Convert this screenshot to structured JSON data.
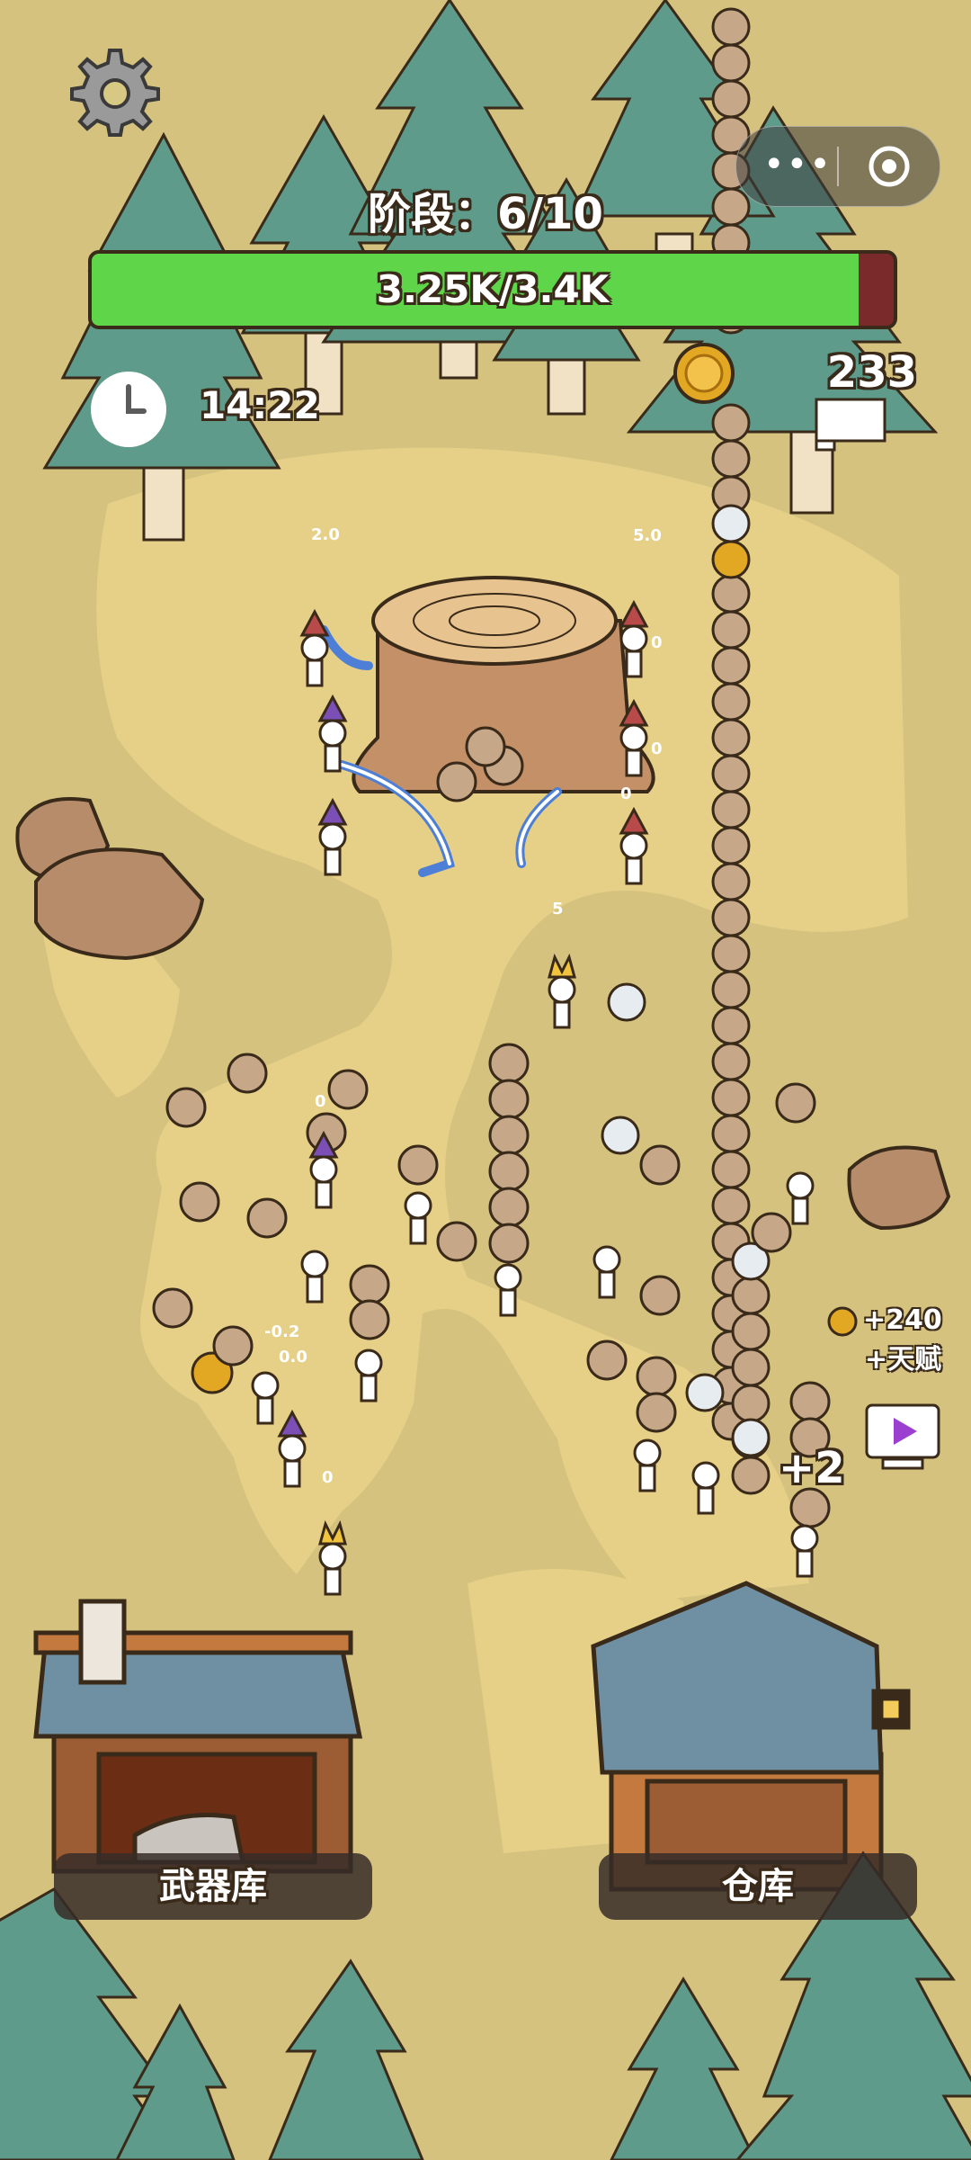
{
  "hud": {
    "stage_label": "阶段：6/10",
    "progress_label": "3.25K/3.4K",
    "progress_fraction": 0.956,
    "timer": "14:22",
    "coins": "233"
  },
  "side": {
    "talent_amount": "+240",
    "talent_label": "+天赋",
    "plus_popup": "+2"
  },
  "buildings": {
    "armory_label": "武器库",
    "warehouse_label": "仓库"
  },
  "damage_numbers": [
    "2.0",
    "5.0",
    "0",
    "0",
    "5",
    "0",
    "0",
    "-0.2",
    "0.0",
    "0"
  ],
  "colors": {
    "ground": "#d7c884",
    "path": "#e6cf86",
    "tree": "#5f9b8a",
    "progress_fill": "#5fd64a",
    "progress_back": "#7a2a2a"
  },
  "icons": [
    "gear-icon",
    "more-icon",
    "target-icon",
    "clock-icon",
    "coin-icon",
    "flag-icon",
    "play-icon"
  ]
}
